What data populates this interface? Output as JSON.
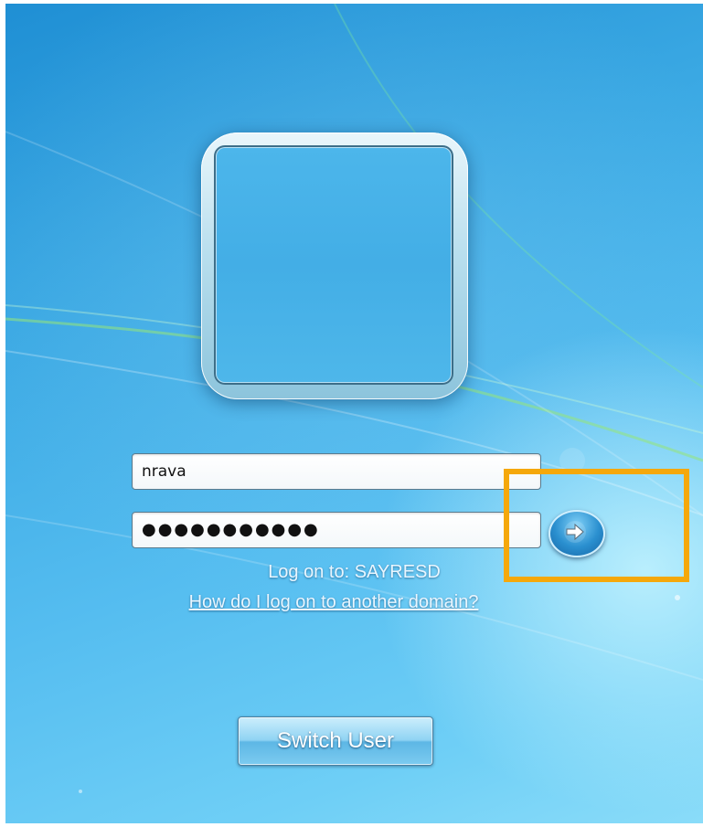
{
  "login": {
    "username_value": "nrava",
    "password_mask": "●●●●●●●●●●●",
    "logon_to_text": "Log on to: SAYRESD",
    "domain_help_link": "How do I log on to another domain?",
    "submit_icon": "arrow-right-icon"
  },
  "footer": {
    "switch_user_label": "Switch User"
  },
  "colors": {
    "background_accent": "#3aa8e3",
    "highlight_box": "#f5a80b"
  }
}
